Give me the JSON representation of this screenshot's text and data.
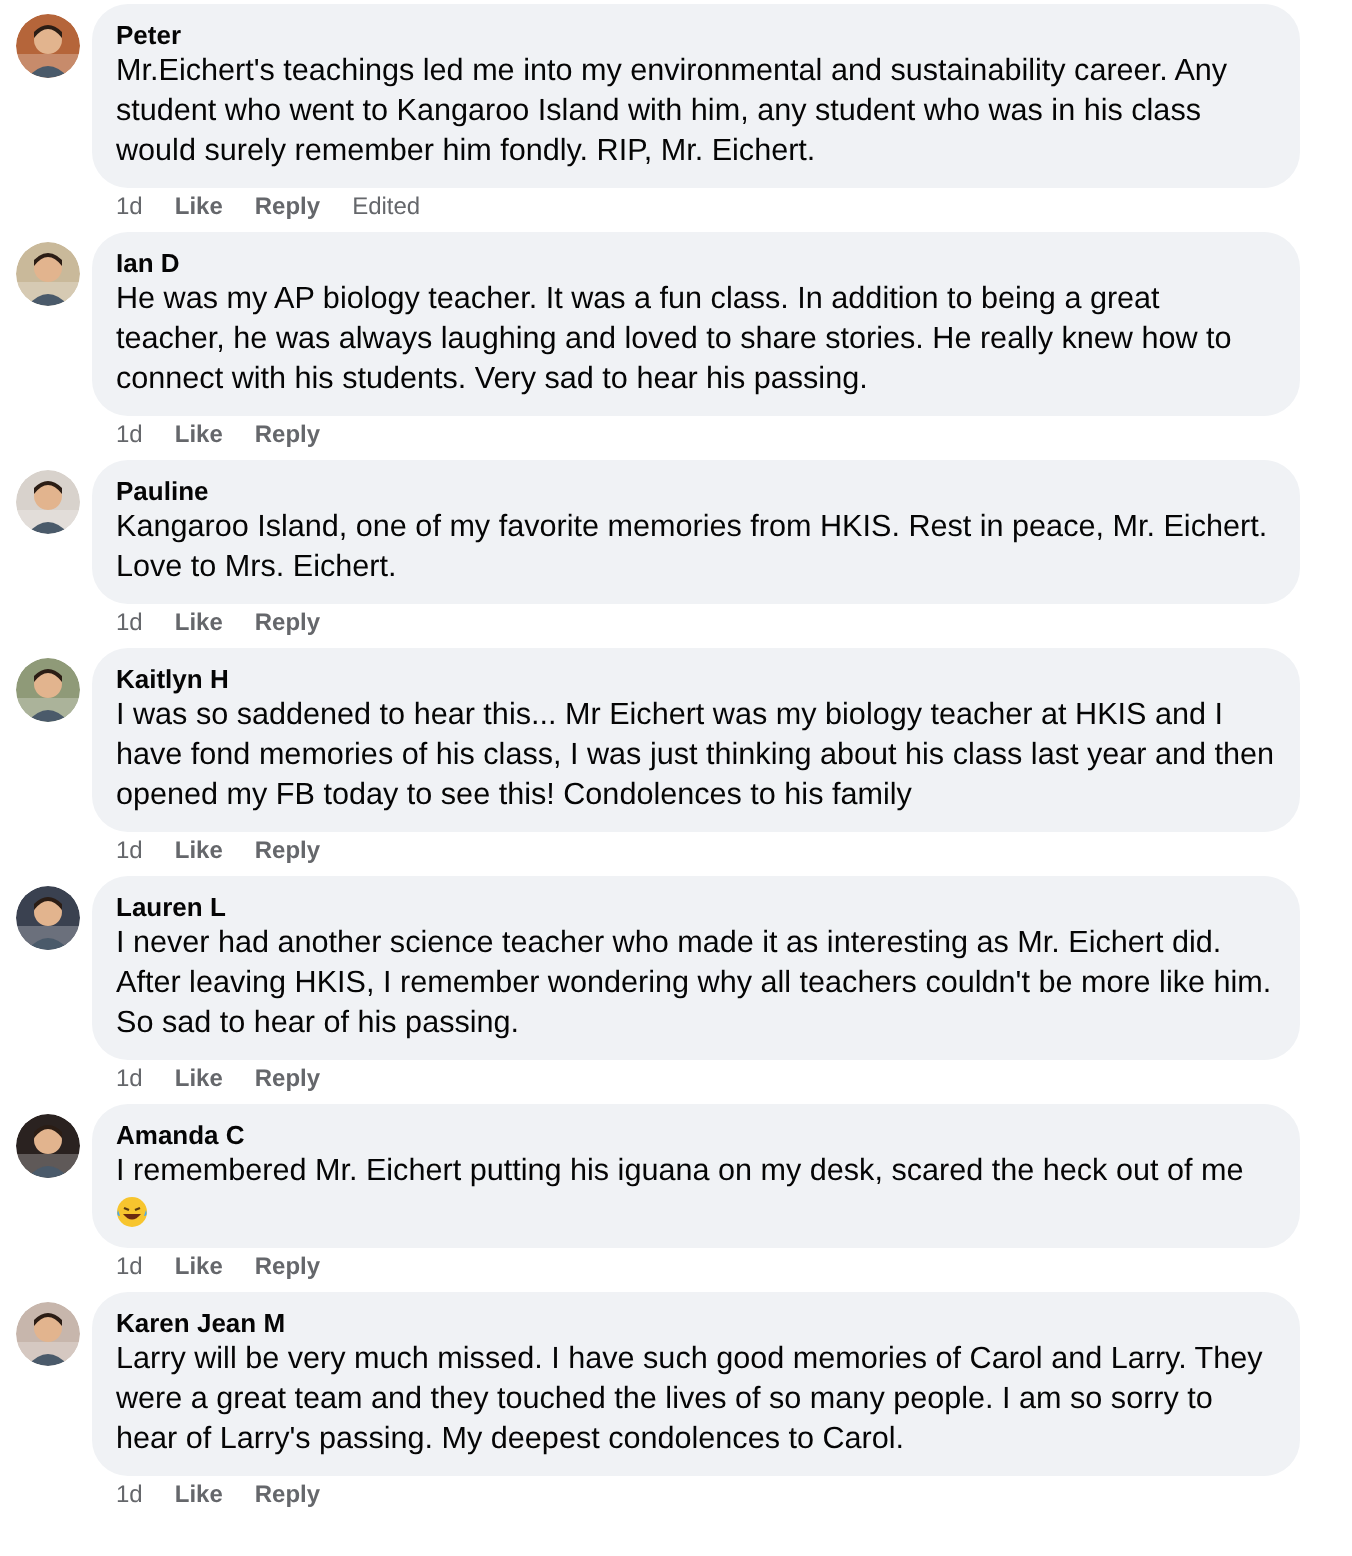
{
  "comments": [
    {
      "author": "Peter",
      "text": "Mr.Eichert's teachings led me into my environmental and sustainability career. Any student who went to Kangaroo Island with him, any student who was in his class would surely remember him fondly. RIP, Mr. Eichert.",
      "time": "1d",
      "like": "Like",
      "reply": "Reply",
      "edited": "Edited"
    },
    {
      "author": "Ian D",
      "text": "He was my AP biology teacher. It was a fun class. In addition to being a great teacher, he was always laughing and loved to share stories. He really knew how to connect with his students. Very sad to hear his passing.",
      "time": "1d",
      "like": "Like",
      "reply": "Reply"
    },
    {
      "author": "Pauline",
      "text": "Kangaroo Island, one of my favorite memories from HKIS. Rest in peace, Mr. Eichert. Love to Mrs. Eichert.",
      "time": "1d",
      "like": "Like",
      "reply": "Reply"
    },
    {
      "author": "Kaitlyn H",
      "text": "I was so saddened to hear this... Mr Eichert was my biology teacher at HKIS and I have fond memories of his class, I was just thinking about his class last year and then opened my FB today to see this! Condolences to his family",
      "time": "1d",
      "like": "Like",
      "reply": "Reply"
    },
    {
      "author": "Lauren L",
      "text": "I never had another science teacher who made it as interesting as Mr. Eichert did. After leaving HKIS, I remember wondering why all teachers couldn't be more like him. So sad to hear of his passing.",
      "time": "1d",
      "like": "Like",
      "reply": "Reply"
    },
    {
      "author": "Amanda C",
      "text": "I remembered Mr. Eichert putting his iguana on my desk, scared the heck out of me",
      "emoji": true,
      "time": "1d",
      "like": "Like",
      "reply": "Reply"
    },
    {
      "author": "Karen Jean M",
      "text": "Larry will be very much missed. I have such good memories of Carol and Larry. They were a great team and they touched the lives of so many people. I am so sorry to hear of Larry's passing. My deepest condolences to Carol.",
      "time": "1d",
      "like": "Like",
      "reply": "Reply"
    }
  ]
}
